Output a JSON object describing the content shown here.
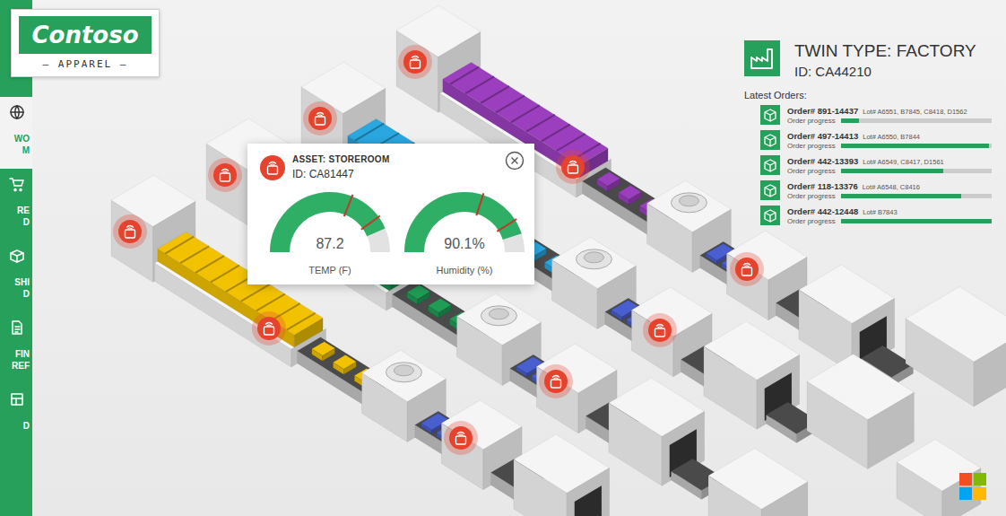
{
  "logo": {
    "name": "Contoso",
    "tagline": "— APPAREL —"
  },
  "sidebar": {
    "items": [
      {
        "lines": [
          "WO",
          "M"
        ],
        "selected": true
      },
      {
        "lines": [
          "RE",
          "D"
        ],
        "selected": false
      },
      {
        "lines": [
          "SHI",
          "D"
        ],
        "selected": false
      },
      {
        "lines": [
          "FIN",
          "REF"
        ],
        "selected": false
      },
      {
        "lines": [
          "D"
        ],
        "selected": false
      }
    ]
  },
  "asset_popup": {
    "title": "ASSET: STOREROOM",
    "id": "ID: CA81447",
    "gauges": [
      {
        "value": "87.2",
        "label": "TEMP (F)",
        "level": 0.87,
        "marks": [
          0.62,
          0.8
        ]
      },
      {
        "value": "90.1%",
        "label": "Humidity (%)",
        "level": 0.9,
        "marks": [
          0.6,
          0.82
        ]
      }
    ]
  },
  "twin": {
    "title": "TWIN TYPE: FACTORY",
    "id": "ID: CA44210",
    "orders_label": "Latest Orders:",
    "orders": [
      {
        "order": "Order# 891-14437",
        "lots": "Lot# A6551, B7845, C8418, D1562",
        "progress_label": "Order progress",
        "level": 0.12
      },
      {
        "order": "Order# 497-14413",
        "lots": "Lot# A6550, B7844",
        "progress_label": "Order progress",
        "level": 0.98
      },
      {
        "order": "Order# 442-13393",
        "lots": "Lot# A6549, C8417, D1561",
        "progress_label": "Order progress",
        "level": 0.68
      },
      {
        "order": "Order# 118-13376",
        "lots": "Lot# A6548, C8416",
        "progress_label": "Order progress",
        "level": 0.8
      },
      {
        "order": "Order# 442-12448",
        "lots": "Lot# B7843",
        "progress_label": "Order progress",
        "level": 1.0
      }
    ]
  }
}
